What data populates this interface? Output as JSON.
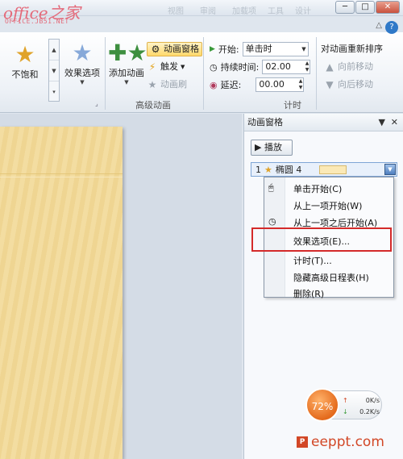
{
  "watermark": {
    "top": "office之家",
    "sub": "OFFICE.JB51.NET",
    "footer": "eeppt.com",
    "footer_icon": "P"
  },
  "window": {
    "menu_faint": [
      "视图",
      "审阅",
      "加载项",
      "工具",
      "设计"
    ],
    "min": "─",
    "restore": "□",
    "close": "✕",
    "help": "?",
    "collapse": "△"
  },
  "ribbon": {
    "gallery": {
      "selected_label": "不饱和"
    },
    "effect_options": "效果选项",
    "add_animation": "添加动画",
    "animation_pane": "动画窗格",
    "trigger": "触发",
    "animation_painter": "动画刷",
    "group_advanced": "高级动画",
    "start_label": "开始:",
    "start_value": "单击时",
    "duration_label": "持续时间:",
    "duration_value": "02.00",
    "delay_label": "延迟:",
    "delay_value": "00.00",
    "group_timing": "计时",
    "reorder_title": "对动画重新排序",
    "move_earlier": "向前移动",
    "move_later": "向后移动"
  },
  "pane": {
    "title": "动画窗格",
    "play": "播放",
    "item_index": "1",
    "item_name": "椭圆 4",
    "ctrl_dropdown": "▼",
    "ctrl_close": "✕"
  },
  "context_menu": [
    "单击开始(C)",
    "从上一项开始(W)",
    "从上一项之后开始(A)",
    "效果选项(E)...",
    "计时(T)...",
    "隐藏高级日程表(H)",
    "删除(R)"
  ],
  "netmeter": {
    "percent": "72%",
    "up": "0K/s",
    "down": "0.2K/s"
  },
  "colors": {
    "highlight": "#d42a2a",
    "accent": "#ffd96b",
    "slide": "#f3dda1"
  }
}
